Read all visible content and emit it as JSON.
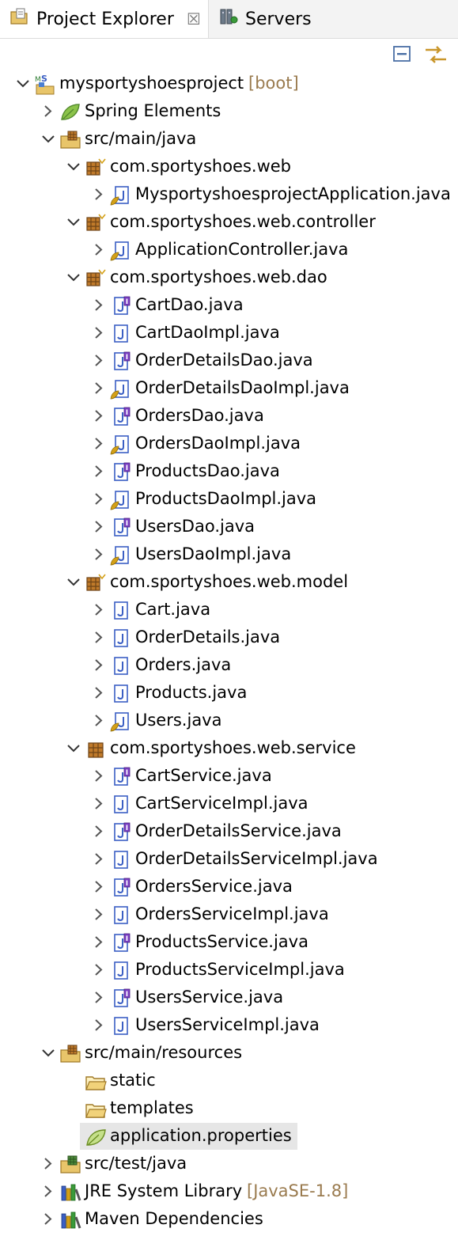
{
  "tabs": [
    {
      "label": "Project Explorer",
      "close": "☒"
    },
    {
      "label": "Servers"
    }
  ],
  "toolbar": [
    "collapse-all-icon",
    "link-with-editor-icon"
  ],
  "tree": [
    {
      "level": 0,
      "expanded": true,
      "icon": "spring-project",
      "label": "mysportyshoesproject",
      "decoration": "[boot]"
    },
    {
      "level": 1,
      "expanded": false,
      "icon": "spring-leaf",
      "label": "Spring Elements"
    },
    {
      "level": 1,
      "expanded": true,
      "icon": "source-folder",
      "label": "src/main/java"
    },
    {
      "level": 2,
      "expanded": true,
      "icon": "package",
      "label": "com.sportyshoes.web"
    },
    {
      "level": 3,
      "expanded": false,
      "icon": "java-class-spring",
      "label": "MysportyshoesprojectApplication.java"
    },
    {
      "level": 2,
      "expanded": true,
      "icon": "package",
      "label": "com.sportyshoes.web.controller"
    },
    {
      "level": 3,
      "expanded": false,
      "icon": "java-class-spring",
      "label": "ApplicationController.java"
    },
    {
      "level": 2,
      "expanded": true,
      "icon": "package",
      "label": "com.sportyshoes.web.dao"
    },
    {
      "level": 3,
      "expanded": false,
      "icon": "java-interface",
      "label": "CartDao.java"
    },
    {
      "level": 3,
      "expanded": false,
      "icon": "java-class",
      "label": "CartDaoImpl.java"
    },
    {
      "level": 3,
      "expanded": false,
      "icon": "java-interface",
      "label": "OrderDetailsDao.java"
    },
    {
      "level": 3,
      "expanded": false,
      "icon": "java-class-spring",
      "label": "OrderDetailsDaoImpl.java"
    },
    {
      "level": 3,
      "expanded": false,
      "icon": "java-interface",
      "label": "OrdersDao.java"
    },
    {
      "level": 3,
      "expanded": false,
      "icon": "java-class-spring",
      "label": "OrdersDaoImpl.java"
    },
    {
      "level": 3,
      "expanded": false,
      "icon": "java-interface",
      "label": "ProductsDao.java"
    },
    {
      "level": 3,
      "expanded": false,
      "icon": "java-class-spring",
      "label": "ProductsDaoImpl.java"
    },
    {
      "level": 3,
      "expanded": false,
      "icon": "java-interface",
      "label": "UsersDao.java"
    },
    {
      "level": 3,
      "expanded": false,
      "icon": "java-class-spring",
      "label": "UsersDaoImpl.java"
    },
    {
      "level": 2,
      "expanded": true,
      "icon": "package",
      "label": "com.sportyshoes.web.model"
    },
    {
      "level": 3,
      "expanded": false,
      "icon": "java-class",
      "label": "Cart.java"
    },
    {
      "level": 3,
      "expanded": false,
      "icon": "java-class",
      "label": "OrderDetails.java"
    },
    {
      "level": 3,
      "expanded": false,
      "icon": "java-class",
      "label": "Orders.java"
    },
    {
      "level": 3,
      "expanded": false,
      "icon": "java-class",
      "label": "Products.java"
    },
    {
      "level": 3,
      "expanded": false,
      "icon": "java-class-spring",
      "label": "Users.java"
    },
    {
      "level": 2,
      "expanded": true,
      "icon": "package-plain",
      "label": "com.sportyshoes.web.service"
    },
    {
      "level": 3,
      "expanded": false,
      "icon": "java-interface",
      "label": "CartService.java"
    },
    {
      "level": 3,
      "expanded": false,
      "icon": "java-class",
      "label": "CartServiceImpl.java"
    },
    {
      "level": 3,
      "expanded": false,
      "icon": "java-interface",
      "label": "OrderDetailsService.java"
    },
    {
      "level": 3,
      "expanded": false,
      "icon": "java-class",
      "label": "OrderDetailsServiceImpl.java"
    },
    {
      "level": 3,
      "expanded": false,
      "icon": "java-interface",
      "label": "OrdersService.java"
    },
    {
      "level": 3,
      "expanded": false,
      "icon": "java-class",
      "label": "OrdersServiceImpl.java"
    },
    {
      "level": 3,
      "expanded": false,
      "icon": "java-interface",
      "label": "ProductsService.java"
    },
    {
      "level": 3,
      "expanded": false,
      "icon": "java-class",
      "label": "ProductsServiceImpl.java"
    },
    {
      "level": 3,
      "expanded": false,
      "icon": "java-interface",
      "label": "UsersService.java"
    },
    {
      "level": 3,
      "expanded": false,
      "icon": "java-class",
      "label": "UsersServiceImpl.java"
    },
    {
      "level": 1,
      "expanded": true,
      "icon": "source-folder",
      "label": "src/main/resources"
    },
    {
      "level": 2,
      "expanded": null,
      "icon": "folder",
      "label": "static"
    },
    {
      "level": 2,
      "expanded": null,
      "icon": "folder",
      "label": "templates"
    },
    {
      "level": 2,
      "expanded": null,
      "icon": "properties-file",
      "label": "application.properties",
      "selected": true
    },
    {
      "level": 1,
      "expanded": false,
      "icon": "source-folder-test",
      "label": "src/test/java"
    },
    {
      "level": 1,
      "expanded": false,
      "icon": "library",
      "label": "JRE System Library",
      "decoration": "[JavaSE-1.8]"
    },
    {
      "level": 1,
      "expanded": false,
      "icon": "library",
      "label": "Maven Dependencies"
    }
  ]
}
